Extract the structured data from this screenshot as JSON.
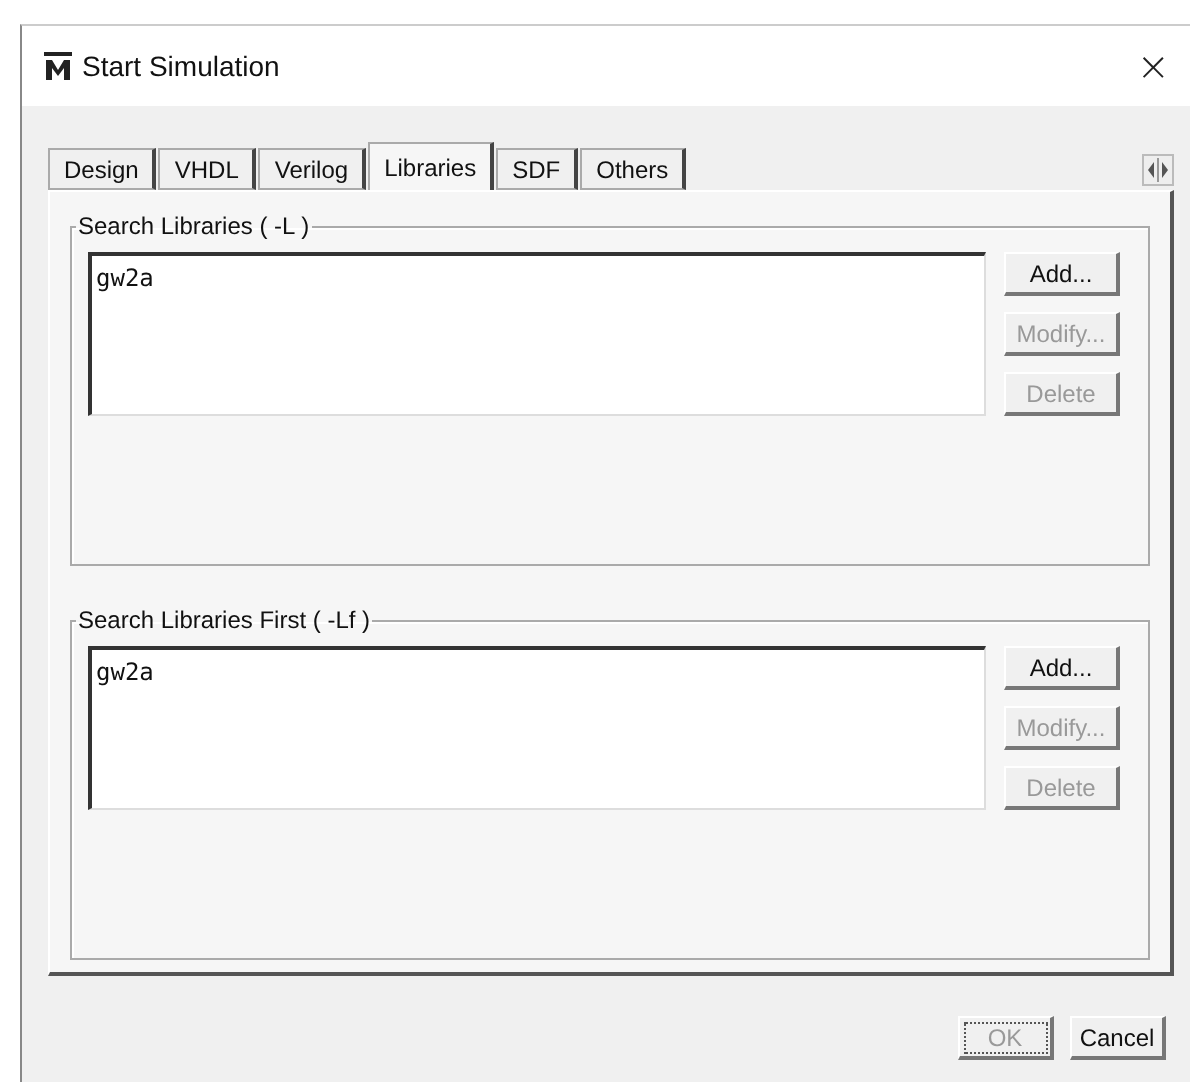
{
  "window": {
    "title": "Start Simulation",
    "close": "×"
  },
  "tabs": [
    {
      "label": "Design",
      "selected": false
    },
    {
      "label": "VHDL",
      "selected": false
    },
    {
      "label": "Verilog",
      "selected": false
    },
    {
      "label": "Libraries",
      "selected": true
    },
    {
      "label": "SDF",
      "selected": false
    },
    {
      "label": "Others",
      "selected": false
    }
  ],
  "groups": [
    {
      "title": "Search Libraries ( -L )",
      "items": [
        "gw2a"
      ],
      "buttons": [
        {
          "label": "Add...",
          "disabled": false
        },
        {
          "label": "Modify...",
          "disabled": true
        },
        {
          "label": "Delete",
          "disabled": true
        }
      ]
    },
    {
      "title": "Search Libraries First ( -Lf )",
      "items": [
        "gw2a"
      ],
      "buttons": [
        {
          "label": "Add...",
          "disabled": false
        },
        {
          "label": "Modify...",
          "disabled": true
        },
        {
          "label": "Delete",
          "disabled": true
        }
      ]
    }
  ],
  "footer_buttons": [
    {
      "label": "OK",
      "disabled": true
    },
    {
      "label": "Cancel",
      "disabled": false
    }
  ]
}
